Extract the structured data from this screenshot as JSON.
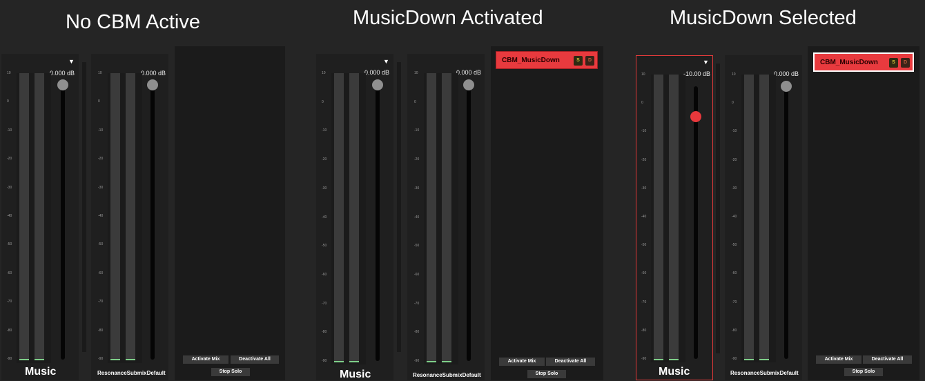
{
  "panels": [
    {
      "title": "No CBM Active",
      "strips": [
        {
          "name": "Music",
          "db": "0.000 dB",
          "has_dropdown": true,
          "fader_value_db": 0,
          "selected": false
        },
        {
          "name": "ResonanceSubmixDefault",
          "db": "0.000 dB",
          "has_dropdown": false,
          "fader_value_db": 0,
          "selected": false
        }
      ],
      "cbm_items": [],
      "buttons": {
        "activate_mix": "Activate Mix",
        "deactivate_all": "Deactivate All",
        "stop_solo": "Stop Solo"
      }
    },
    {
      "title": "MusicDown Activated",
      "strips": [
        {
          "name": "Music",
          "db": "0.000 dB",
          "has_dropdown": true,
          "fader_value_db": 0,
          "selected": false
        },
        {
          "name": "ResonanceSubmixDefault",
          "db": "0.000 dB",
          "has_dropdown": false,
          "fader_value_db": 0,
          "selected": false
        }
      ],
      "cbm_items": [
        {
          "label": "CBM_MusicDown",
          "solo": "S",
          "deactivate": "D",
          "selected": false
        }
      ],
      "buttons": {
        "activate_mix": "Activate Mix",
        "deactivate_all": "Deactivate All",
        "stop_solo": "Stop Solo"
      }
    },
    {
      "title": "MusicDown Selected",
      "strips": [
        {
          "name": "Music",
          "db": "-10.00 dB",
          "has_dropdown": true,
          "fader_value_db": -10,
          "selected": true
        },
        {
          "name": "ResonanceSubmixDefault",
          "db": "0.000 dB",
          "has_dropdown": false,
          "fader_value_db": 0,
          "selected": false
        }
      ],
      "cbm_items": [
        {
          "label": "CBM_MusicDown",
          "solo": "S",
          "deactivate": "D",
          "selected": true
        }
      ],
      "buttons": {
        "activate_mix": "Activate Mix",
        "deactivate_all": "Deactivate All",
        "stop_solo": "Stop Solo"
      }
    }
  ],
  "scale_labels": [
    "10",
    "0",
    "-10",
    "-20",
    "-30",
    "-40",
    "-50",
    "-60",
    "-70",
    "-80",
    "-90"
  ],
  "fader_range_db": [
    -90,
    10
  ],
  "colors": {
    "background": "#252525",
    "strip": "#1f1f1f",
    "cbm_item": "#e83a3e",
    "active_knob": "#e8383c",
    "idle_knob": "#8f8f8f",
    "selection_border": "#e03a3a",
    "meter_peak": "#7fd08a"
  },
  "icons": {
    "dropdown": "triangle-down-icon"
  }
}
